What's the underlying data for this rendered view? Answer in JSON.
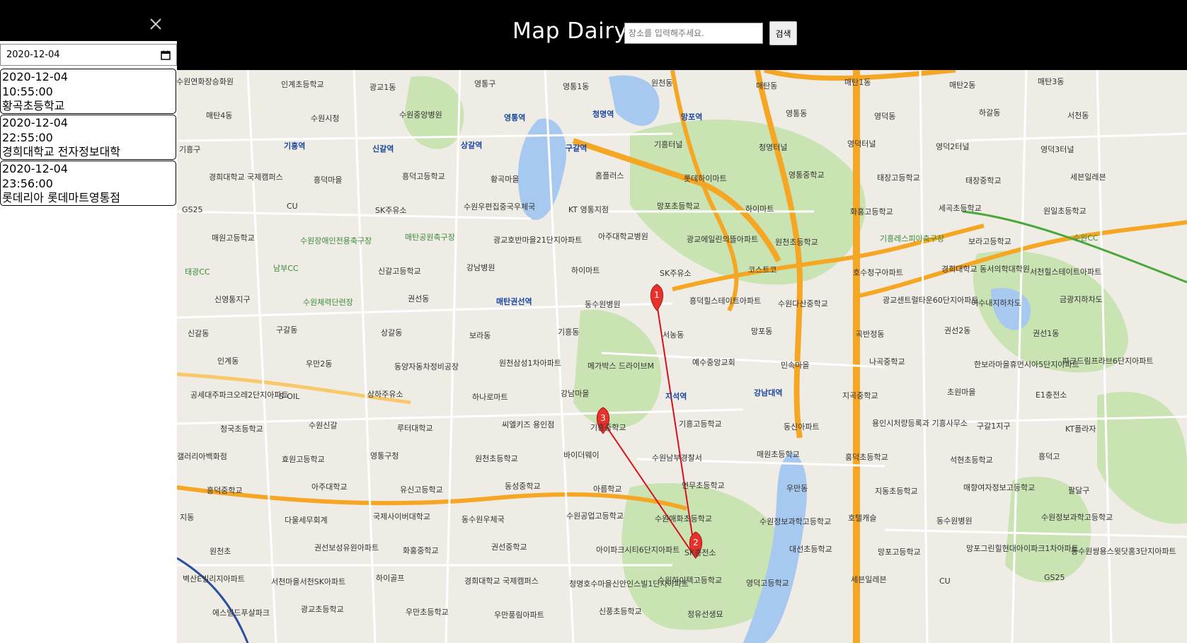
{
  "header": {
    "title": "Map Dairy",
    "search_placeholder": "장소를 입력해주세요.",
    "search_button": "검색"
  },
  "sidebar": {
    "close_icon": "close-icon",
    "date_value": "2020-12-04",
    "entries": [
      {
        "date": "2020-12-04",
        "time": "10:55:00",
        "place": "황곡초등학교"
      },
      {
        "date": "2020-12-04",
        "time": "22:55:00",
        "place": "경희대학교 전자정보대학"
      },
      {
        "date": "2020-12-04",
        "time": "23:56:00",
        "place": "롯데리아 롯데마트영통점"
      }
    ]
  },
  "map": {
    "markers": [
      {
        "label": "1"
      },
      {
        "label": "2"
      },
      {
        "label": "3"
      }
    ],
    "colors": {
      "marker": "#e8312b",
      "route": "#d9101c",
      "highway": "#f5a623"
    },
    "labels": [
      "수원연화장승화원",
      "인계초등학교",
      "광교1동",
      "영통구",
      "영통1동",
      "원천동",
      "매탄동",
      "매탄1동",
      "매탄2동",
      "매탄3동",
      "매탄4동",
      "수원시청",
      "수원중앙병원",
      "영통역",
      "청명역",
      "망포역",
      "영통동",
      "영덕동",
      "하갈동",
      "서천동",
      "기흥구",
      "기흥역",
      "신갈역",
      "상갈역",
      "구갈역",
      "기흥터널",
      "청명터널",
      "영덕터널",
      "영덕2터널",
      "영덕3터널",
      "경희대학교 국제캠퍼스",
      "흥덕마을",
      "흥덕고등학교",
      "황곡마을",
      "홈플러스",
      "롯데하이마트",
      "영통중학교",
      "태장고등학교",
      "태장중학교",
      "세븐일레븐",
      "GS25",
      "CU",
      "SK주유소",
      "수원우편집중국우체국",
      "KT 영통지점",
      "망포초등학교",
      "하이마트",
      "화홍고등학교",
      "세곡초등학교",
      "원일초등학교",
      "매원고등학교",
      "수원장애인전용축구장",
      "매탄공원축구장",
      "광교호반마을21단지아파트",
      "아주대학교병원",
      "광교에일린의뜰아파트",
      "원천초등학교",
      "기흥레스피아축구장",
      "보라고등학교",
      "수원CC",
      "태광CC",
      "남부CC",
      "신갈고등학교",
      "강남병원",
      "하이마트",
      "SK주유소",
      "코스트코",
      "호수청구아파트",
      "경희대학교 동서의학대학원",
      "서천힐스테이트아파트",
      "신영통지구",
      "수원체력단련장",
      "권선동",
      "매탄권선역",
      "동수원병원",
      "흥덕힐스테이트아파트",
      "수원다산중학교",
      "광교센트럴타운60단지아파트",
      "여수내지하차도",
      "금광지하차도",
      "신갈동",
      "구갈동",
      "상갈동",
      "보라동",
      "기흥동",
      "서농동",
      "망포동",
      "곡반정동",
      "권선2동",
      "권선1동",
      "인계동",
      "우만2동",
      "동양자동차정비공장",
      "원천삼성1차아파트",
      "메가박스 드라이브M",
      "예수중앙교회",
      "민속마을",
      "나곡중학교",
      "한보라마을휴먼시아5단지아파트",
      "파크드림프라브6단지아파트",
      "공세대주파크오레2단지아파트",
      "S-OIL",
      "상하주유소",
      "하나로마트",
      "강남마을",
      "지석역",
      "강남대역",
      "지곡중학교",
      "초원마을",
      "E1충전소",
      "청국초등학교",
      "수원신갈",
      "루터대학교",
      "씨엘키즈 용인점",
      "기흥중학교",
      "기흥고등학교",
      "동신아파트",
      "용인시처량등록과 기흥사무소",
      "구갈1지구",
      "KT플라자",
      "갤러리아백화점",
      "효원고등학교",
      "영통구청",
      "원천초등학교",
      "바이더웨이",
      "수원남부경찰서",
      "매원초등학교",
      "홍덕초등학교",
      "석현초등학교",
      "흥덕고",
      "흥덕중학교",
      "아주대학교",
      "유신고등학교",
      "동성중학교",
      "아름학교",
      "연무초등학교",
      "우만동",
      "지동초등학교",
      "매향여자정보고등학교",
      "팔달구",
      "지동",
      "다울세무회계",
      "국제사이버대학교",
      "동수원우체국",
      "수원공업고등학교",
      "수원매화초등학교",
      "수원정보과학고등학교",
      "호텔캐슬",
      "동수원병원",
      "수원정보과학고등학교",
      "원천초",
      "권선보성유원아파트",
      "화홍중학교",
      "권선중학교",
      "아이파크시티6단지아파트",
      "SK충전소",
      "대선초등학교",
      "망포고등학교",
      "망포그린힐현대아이파크1차아파트",
      "동수원쌍용스윗닷홈3단지아파트",
      "벽산E빌리지아파트",
      "서천마을서천SK아파트",
      "하이골프",
      "경희대학교 국제캠퍼스",
      "청명호수마을신안인스빌1단지아파트",
      "수원하이텍고등학교",
      "영덕고등학교",
      "세븐일레븐",
      "CU",
      "GS25",
      "에스빌드푸살파크",
      "광교초등학교",
      "우만초등학교",
      "우만풍림아파트",
      "신풍초등학교",
      "정유선생묘"
    ]
  }
}
